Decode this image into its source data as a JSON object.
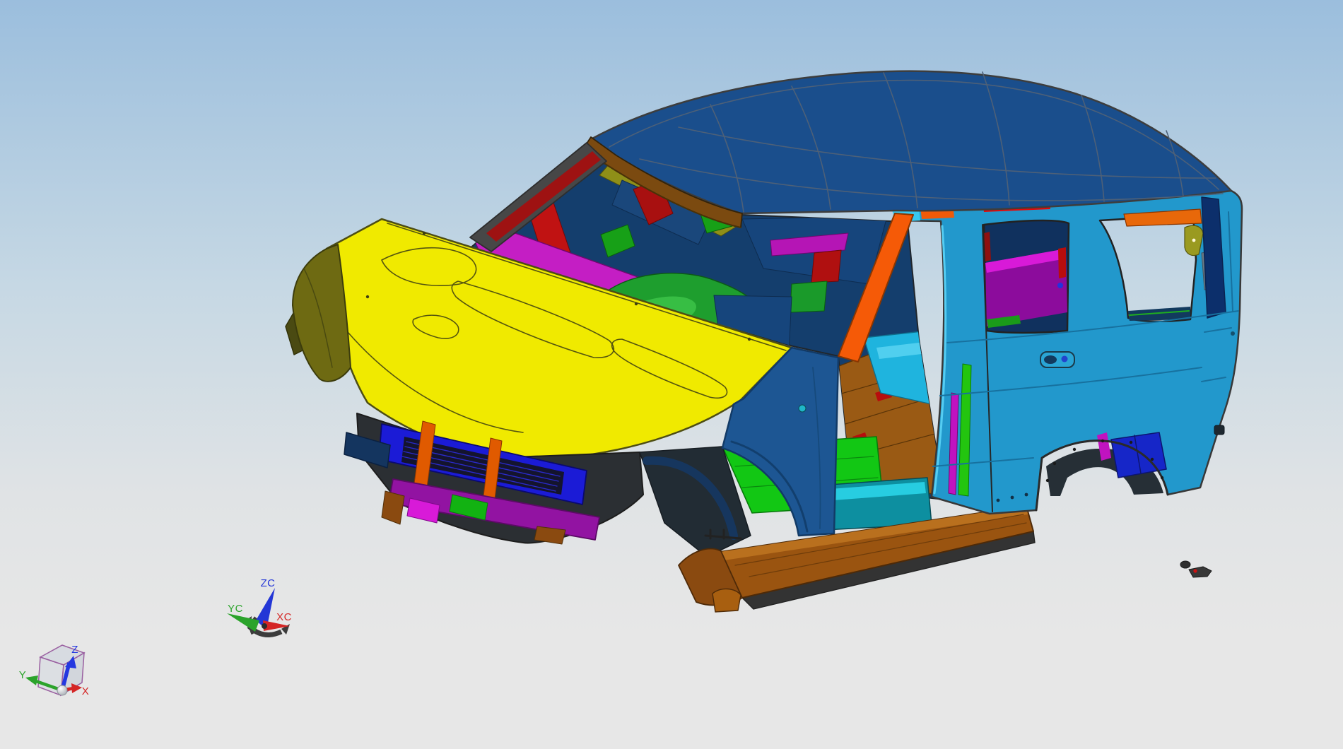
{
  "background": {
    "sky_top": "#9bbedd",
    "sky_mid": "#c6d8e4",
    "ground": "#e7e7e7"
  },
  "view_cube_triad": {
    "labels": {
      "z": "Z",
      "y": "Y",
      "x": "X"
    },
    "colors": {
      "z_axis": "#2438e0",
      "y_axis": "#2ba32b",
      "x_axis": "#d42525",
      "cube_edge": "#a06aa8"
    }
  },
  "wcs_triad": {
    "labels": {
      "zc": "ZC",
      "yc": "YC",
      "xc": "XC"
    },
    "colors": {
      "zc_axis": "#2336d6",
      "yc_axis": "#2ba32b",
      "xc_axis": "#d42525",
      "rotate_handle": "#3c3c3c"
    }
  },
  "model": {
    "subject": "SUV body-in-white assembly",
    "colors": {
      "roof": "#1a4e8c",
      "header_brown": "#7b4a10",
      "hood": "#f0ea00",
      "fender_olive": "#6e6a12",
      "fender_blue": "#1d5693",
      "body_side": "#2298cc",
      "rocker_brown": "#9a5410",
      "sill_teal": "#0d8fa0",
      "floor_pan_green": "#12c714",
      "floor_cyan": "#1fb4de",
      "floor_brown": "#9a5a14",
      "dash_green": "#1e9e2e",
      "cowl_magenta": "#c41ec4",
      "cargo_purple": "#8c0c9c",
      "interior_navy": "#143e6d",
      "a_pillar_orange": "#f55a07",
      "a_pillar_red": "#9e1212",
      "radiator_blue": "#1b1bd6",
      "bumper_purple": "#9213a2",
      "arch_box_blue": "#1626c8",
      "d_pillar_navy": "#0c2f6b",
      "rail_red": "#e20a0a",
      "edge": "#3d3d3d"
    }
  }
}
